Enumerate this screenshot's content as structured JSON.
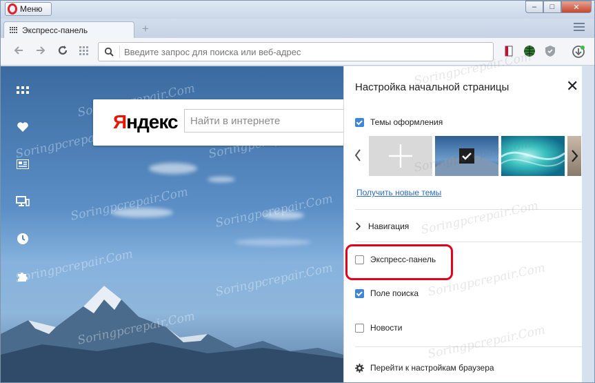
{
  "window": {
    "menu_label": "Меню",
    "controls": {
      "minimize": "‒",
      "maximize": "□",
      "close": "✕"
    }
  },
  "tabs": [
    {
      "label": "Экспресс-панель",
      "icon": "speed-dial-icon"
    }
  ],
  "toolbar": {
    "address_placeholder": "Введите запрос для поиска или веб-адрес",
    "icons": [
      "back-icon",
      "forward-icon",
      "reload-icon",
      "speed-dial-icon",
      "search-icon",
      "bookmark-icon",
      "globe-icon",
      "shield-icon",
      "download-icon"
    ]
  },
  "sidebar": {
    "items": [
      "speed-dial-icon",
      "heart-icon",
      "news-icon",
      "devices-icon",
      "history-icon",
      "extensions-icon"
    ]
  },
  "yandex": {
    "logo_first": "Я",
    "logo_rest": "ндекс",
    "search_placeholder": "Найти в интернете"
  },
  "panel": {
    "title": "Настройка начальной страницы",
    "close_label": "✕",
    "themes_label": "Темы оформления",
    "themes_checked": true,
    "get_themes_link": "Получить новые темы",
    "navigation_label": "Навигация",
    "speed_dial_label": "Экспресс-панель",
    "speed_dial_checked": false,
    "search_field_label": "Поле поиска",
    "search_field_checked": true,
    "news_label": "Новости",
    "news_checked": false,
    "browser_settings_label": "Перейти к настройкам браузера"
  },
  "colors": {
    "accent": "#3f86d9",
    "highlight": "#e3001b",
    "opera_red": "#e0202a",
    "yandex_red": "#e61400"
  }
}
